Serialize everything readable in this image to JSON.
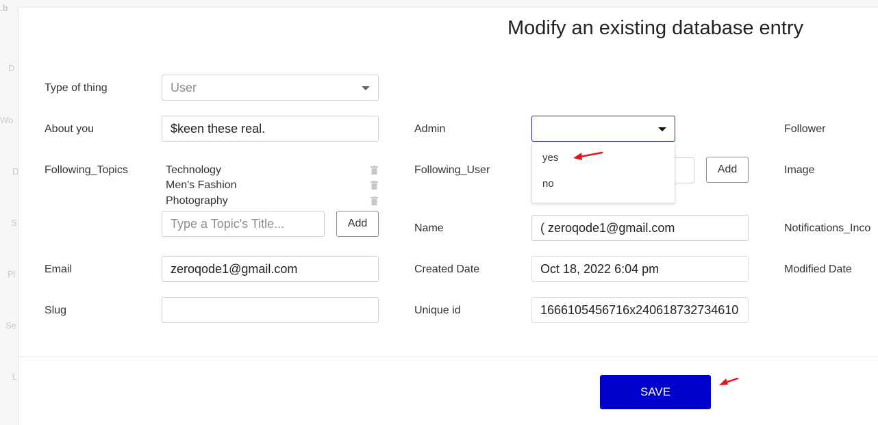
{
  "background": {
    "logo": ".b",
    "sidebar_fragments": [
      "D",
      "Wo",
      "D",
      "S",
      "Pl",
      "Se",
      "L"
    ]
  },
  "modal": {
    "title": "Modify an existing database entry",
    "fields": {
      "type_of_thing": {
        "label": "Type of thing",
        "value": "User"
      },
      "about_you": {
        "label": "About you",
        "value": "$keen these real."
      },
      "following_topics": {
        "label": "Following_Topics",
        "items": [
          "Technology",
          "Men's Fashion",
          "Photography"
        ],
        "placeholder": "Type a Topic's Title...",
        "add_label": "Add"
      },
      "email": {
        "label": "Email",
        "value": "zeroqode1@gmail.com"
      },
      "slug": {
        "label": "Slug",
        "value": ""
      },
      "admin": {
        "label": "Admin",
        "value": "",
        "options": [
          "yes",
          "no"
        ]
      },
      "following_user": {
        "label": "Following_User",
        "add_label": "Add"
      },
      "name": {
        "label": "Name",
        "value": "( zeroqode1@gmail.com"
      },
      "created_date": {
        "label": "Created Date",
        "value": "Oct 18, 2022 6:04 pm"
      },
      "unique_id": {
        "label": "Unique id",
        "value": "1666105456716x240618732734610"
      },
      "follower": {
        "label": "Follower"
      },
      "image": {
        "label": "Image"
      },
      "notifications": {
        "label": "Notifications_Inco"
      },
      "modified_date": {
        "label": "Modified Date"
      }
    },
    "save_label": "SAVE"
  },
  "colors": {
    "save_button": "#0000cc",
    "active_border": "#1a1adb",
    "annotation_arrow": "#e8141b"
  }
}
